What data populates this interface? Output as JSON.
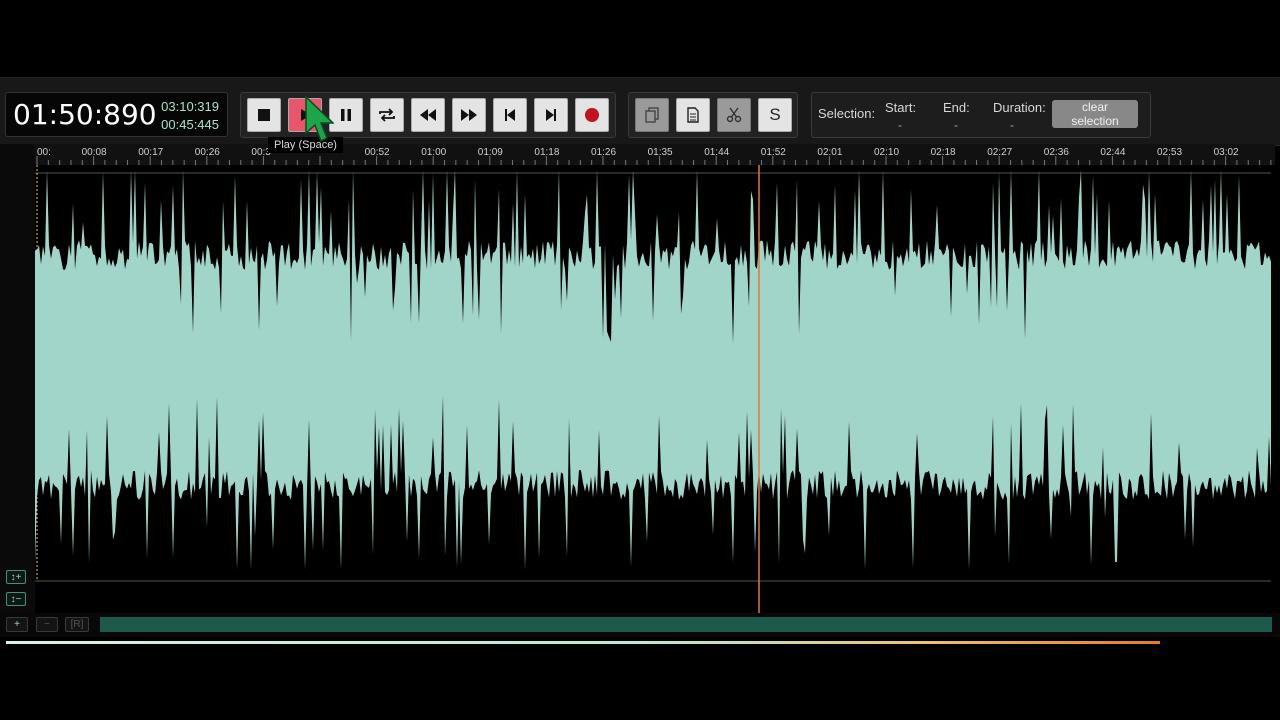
{
  "timer": {
    "current": "01:50:890",
    "total": "03:10:319",
    "remaining": "00:45:445"
  },
  "transport": {
    "buttons": [
      {
        "name": "stop-button",
        "icon": "stop-icon",
        "tooltip": ""
      },
      {
        "name": "play-button",
        "icon": "play-icon",
        "tooltip": "Play (Space)",
        "active": true
      },
      {
        "name": "pause-button",
        "icon": "pause-icon"
      },
      {
        "name": "loop-button",
        "icon": "loop-icon"
      },
      {
        "name": "rewind-button",
        "icon": "rewind-icon"
      },
      {
        "name": "fast-forward-button",
        "icon": "fast-forward-icon"
      },
      {
        "name": "skip-start-button",
        "icon": "skip-start-icon"
      },
      {
        "name": "skip-end-button",
        "icon": "skip-end-icon"
      },
      {
        "name": "record-button",
        "icon": "record-icon"
      }
    ]
  },
  "edit": {
    "copy_icon": "copy-icon",
    "paste_icon": "paste-icon",
    "cut_icon": "scissors-icon",
    "s_label": "S"
  },
  "tooltip": "Play (Space)",
  "selection": {
    "label": "Selection:",
    "start_label": "Start:",
    "start_value": "-",
    "end_label": "End:",
    "end_value": "-",
    "duration_label": "Duration:",
    "duration_value": "-",
    "clear_label": "clear selection"
  },
  "ruler": {
    "ticks": [
      "00:",
      "00:08",
      "00:17",
      "00:26",
      "00:3",
      "",
      "00:52",
      "01:00",
      "01:09",
      "01:18",
      "01:26",
      "01:35",
      "01:44",
      "01:52",
      "02:01",
      "02:10",
      "02:18",
      "02:27",
      "02:36",
      "02:44",
      "02:53",
      "03:02"
    ]
  },
  "left_controls": {
    "zoom_in_v": "↕+",
    "zoom_out_v": "↕−"
  },
  "bottom_controls": {
    "zoom_in": "+",
    "zoom_out": "−",
    "reset": "[R]"
  },
  "colors": {
    "waveform": "#a2d5ca",
    "playhead": "#e07a3a",
    "active_button": "#e8566b",
    "scrollbar": "#1d5a4b"
  },
  "playback": {
    "position_fraction": 0.584
  }
}
